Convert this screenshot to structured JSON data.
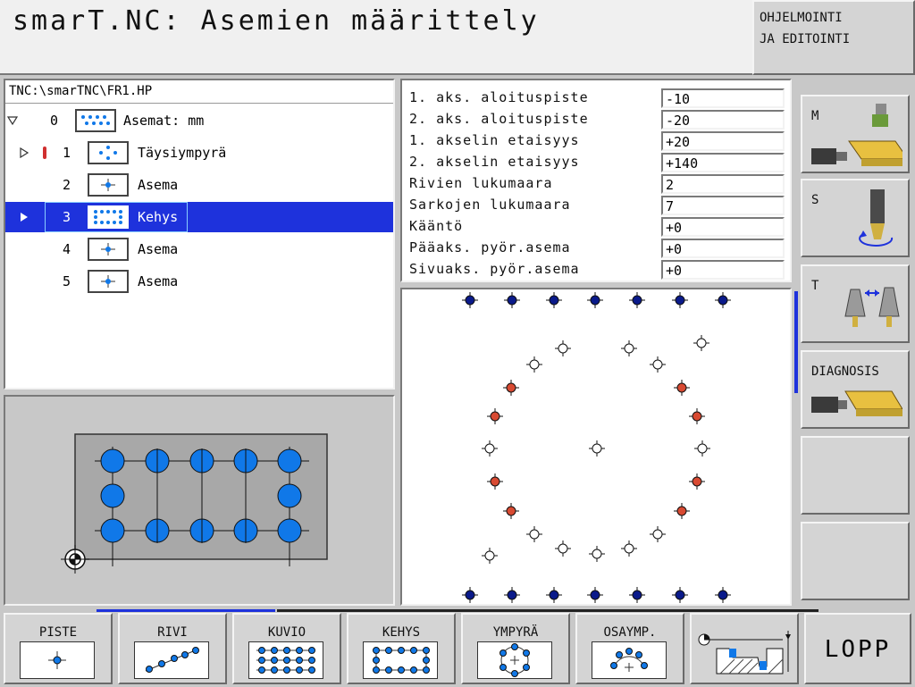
{
  "header": {
    "title": "smarT.NC: Asemien määrittely",
    "mode_line1": "OHJELMOINTI",
    "mode_line2": "JA EDITOINTI"
  },
  "tree": {
    "path": "TNC:\\smarTNC\\FR1.HP",
    "rows": [
      {
        "num": "0",
        "label": "Asemat: mm"
      },
      {
        "num": "1",
        "label": "Täysiympyrä"
      },
      {
        "num": "2",
        "label": "Asema"
      },
      {
        "num": "3",
        "label": "Kehys"
      },
      {
        "num": "4",
        "label": "Asema"
      },
      {
        "num": "5",
        "label": "Asema"
      }
    ],
    "selected_index": 3
  },
  "form": {
    "fields": [
      {
        "label": "1. aks. aloituspiste",
        "value": "-10"
      },
      {
        "label": "2. aks. aloituspiste",
        "value": "-20"
      },
      {
        "label": "1. akselin etaisyys",
        "value": "+20"
      },
      {
        "label": "2. akselin etaisyys",
        "value": "+140"
      },
      {
        "label": "Rivien lukumaara",
        "value": "2"
      },
      {
        "label": "Sarkojen lukumaara",
        "value": "7"
      },
      {
        "label": "Kääntö",
        "value": "+0"
      },
      {
        "label": "Pääaks. pyör.asema",
        "value": "+0"
      },
      {
        "label": "Sivuaks. pyör.asema",
        "value": "+0"
      }
    ]
  },
  "sidebar": {
    "buttons": [
      {
        "label": "M",
        "icon": "machine-mill-icon"
      },
      {
        "label": "S",
        "icon": "spindle-icon"
      },
      {
        "label": "T",
        "icon": "tool-change-icon"
      },
      {
        "label": "DIAGNOSIS",
        "icon": "diagnosis-icon"
      },
      {
        "label": "",
        "icon": ""
      },
      {
        "label": "",
        "icon": ""
      }
    ]
  },
  "softkeys": [
    {
      "label": "PISTE",
      "icon": "point-icon"
    },
    {
      "label": "RIVI",
      "icon": "row-icon"
    },
    {
      "label": "KUVIO",
      "icon": "pattern-icon"
    },
    {
      "label": "KEHYS",
      "icon": "frame-icon"
    },
    {
      "label": "YMPYRÄ",
      "icon": "circle-pattern-icon"
    },
    {
      "label": "OSAYMP.",
      "icon": "arc-pattern-icon"
    },
    {
      "label": "",
      "icon": "contour-icon"
    },
    {
      "label": "LOPP",
      "icon": ""
    }
  ],
  "colors": {
    "accent": "#1e32dc",
    "point_blue": "#0a1a8a",
    "point_red": "#d84a32",
    "hole_blue": "#1078e8"
  }
}
